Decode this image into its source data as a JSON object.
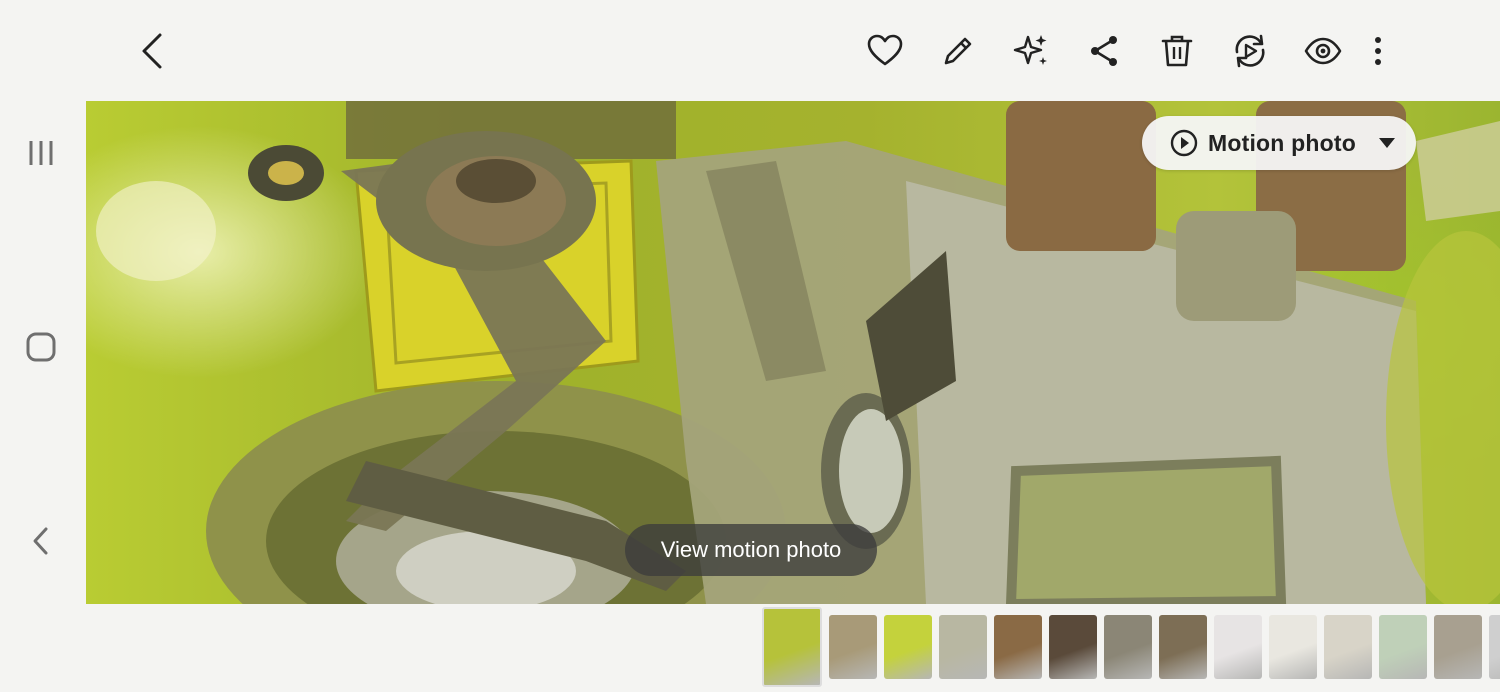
{
  "header": {
    "back_icon": "chevron-left-icon",
    "actions": [
      {
        "name": "favorite-button",
        "icon": "heart-icon"
      },
      {
        "name": "edit-button",
        "icon": "pencil-icon"
      },
      {
        "name": "ai-edit-button",
        "icon": "sparkle-icon"
      },
      {
        "name": "share-button",
        "icon": "share-icon"
      },
      {
        "name": "delete-button",
        "icon": "trash-icon"
      },
      {
        "name": "remaster-button",
        "icon": "refresh-play-icon"
      },
      {
        "name": "bixby-vision-button",
        "icon": "eye-icon"
      },
      {
        "name": "more-options-button",
        "icon": "more-vertical-icon"
      }
    ]
  },
  "system_nav": {
    "recents_icon": "recents-icon",
    "home_icon": "home-icon",
    "back_icon": "back-icon"
  },
  "photo": {
    "motion_toggle_label": "Motion photo",
    "view_motion_label": "View motion photo"
  },
  "filmstrip": {
    "thumbnails": [
      {
        "tone": "#b6c23a",
        "active": true
      },
      {
        "tone": "#a89a78"
      },
      {
        "tone": "#c4d23c"
      },
      {
        "tone": "#b8b7a2"
      },
      {
        "tone": "#8a6a45"
      },
      {
        "tone": "#5a4a3a"
      },
      {
        "tone": "#8b8676"
      },
      {
        "tone": "#7d6e55"
      },
      {
        "tone": "#e7e4e4"
      },
      {
        "tone": "#e9e7e0"
      },
      {
        "tone": "#d8d4c8"
      },
      {
        "tone": "#bfd0b8"
      },
      {
        "tone": "#a8a090"
      },
      {
        "tone": "#cfcfcf"
      }
    ]
  },
  "colors": {
    "icon": "#222222",
    "system_icon": "#6f6f6f",
    "pill_bg": "#f6f6f6",
    "toast_bg": "#3c3c3c"
  }
}
